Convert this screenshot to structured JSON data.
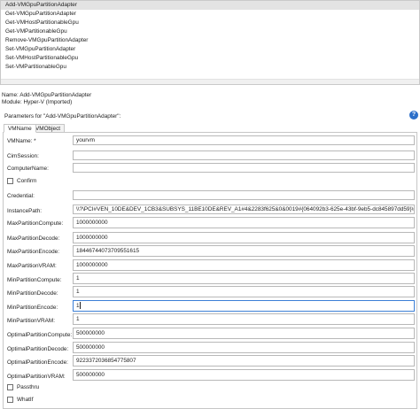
{
  "cmdlets": [
    "Add-VMGpuPartitionAdapter",
    "Get-VMGpuPartitionAdapter",
    "Get-VMHostPartitionableGpu",
    "Get-VMPartitionableGpu",
    "Remove-VMGpuPartitionAdapter",
    "Set-VMGpuPartitionAdapter",
    "Set-VMHostPartitionableGpu",
    "Set-VMPartitionableGpu"
  ],
  "selected_cmdlet_index": 0,
  "info": {
    "name": "Name: Add-VMGpuPartitionAdapter",
    "module": "Module: Hyper-V (Imported)"
  },
  "params_title": "Parameters for \"Add-VMGpuPartitionAdapter\":",
  "help_symbol": "?",
  "tabs": {
    "vmname": "VMName",
    "vmobject": "VMObject",
    "active": "vmname"
  },
  "fields": {
    "vmname": {
      "label": "VMName: *",
      "value": "yourvm"
    },
    "cimsession": {
      "label": "CimSession:",
      "value": ""
    },
    "computername": {
      "label": "ComputerName:",
      "value": ""
    },
    "credential": {
      "label": "Credential:",
      "value": ""
    },
    "instancepath": {
      "label": "InstancePath:",
      "value": "\\\\?\\PCI#VEN_10DE&DEV_1CB3&SUBSYS_11BE10DE&REV_A1#4&2283f625&0&0019#{064092b3-625e-43bf-9eb5-dc845897dd59}\\GPUPARAV"
    },
    "maxpartitioncompute": {
      "label": "MaxPartitionCompute:",
      "value": "1000000000"
    },
    "maxpartitiondecode": {
      "label": "MaxPartitionDecode:",
      "value": "1000000000"
    },
    "maxpartitionencode": {
      "label": "MaxPartitionEncode:",
      "value": "18446744073709551615"
    },
    "maxpartitionvram": {
      "label": "MaxPartitionVRAM:",
      "value": "1000000000"
    },
    "minpartitioncompute": {
      "label": "MinPartitionCompute:",
      "value": "1"
    },
    "minpartitiondecode": {
      "label": "MinPartitionDecode:",
      "value": "1"
    },
    "minpartitionencode": {
      "label": "MinPartitionEncode:",
      "value": "1"
    },
    "minpartitionvram": {
      "label": "MinPartitionVRAM:",
      "value": "1"
    },
    "optimalpartitioncompute": {
      "label": "OptimalPartitionCompute:",
      "value": "500000000"
    },
    "optimalpartitiondecode": {
      "label": "OptimalPartitionDecode:",
      "value": "500000000"
    },
    "optimalpartitionencode": {
      "label": "OptimalPartitionEncode:",
      "value": "9223372036854775807"
    },
    "optimalpartitionvram": {
      "label": "OptimalPartitionVRAM:",
      "value": "500000000"
    }
  },
  "checkboxes": {
    "confirm": {
      "label": "Confirm",
      "checked": false
    },
    "passthru": {
      "label": "Passthru",
      "checked": false
    },
    "whatif": {
      "label": "WhatIf",
      "checked": false
    }
  }
}
